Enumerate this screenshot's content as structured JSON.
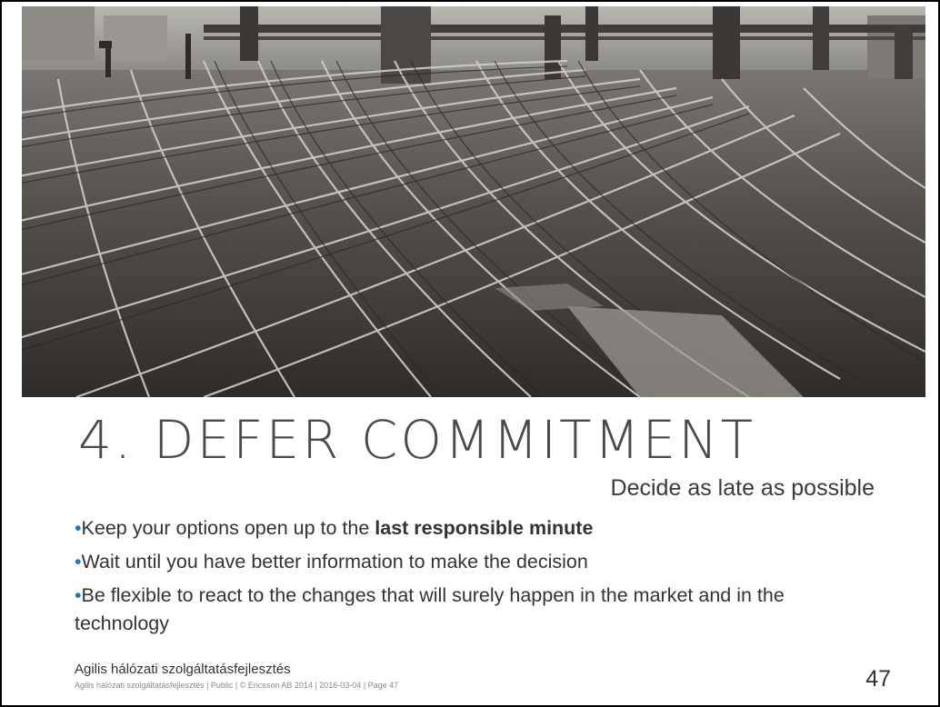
{
  "slide": {
    "title": "4. DEFER COMMITMENT",
    "subtitle": "Decide as late as possible",
    "photo_icon": "railway-tracks-photo",
    "bullet_color": "#1f76c2",
    "bullets": [
      {
        "marker": "•",
        "text": "Keep your options open up to the ",
        "bold": "last responsible minute"
      },
      {
        "marker": "•",
        "text": "Wait until you have better information to make the decision"
      },
      {
        "marker": "•",
        "text": "Be flexible to react to the changes that will surely happen in the market and in the technology"
      }
    ],
    "footer": {
      "title": "Agilis hálózati szolgáltatásfejlesztés",
      "meta": "Agilis hálózati szolgáltatásfejlesztés  |  Public  |  © Ericsson AB 2014  |  2016-03-04  |  Page 47"
    },
    "page_number": "47"
  }
}
